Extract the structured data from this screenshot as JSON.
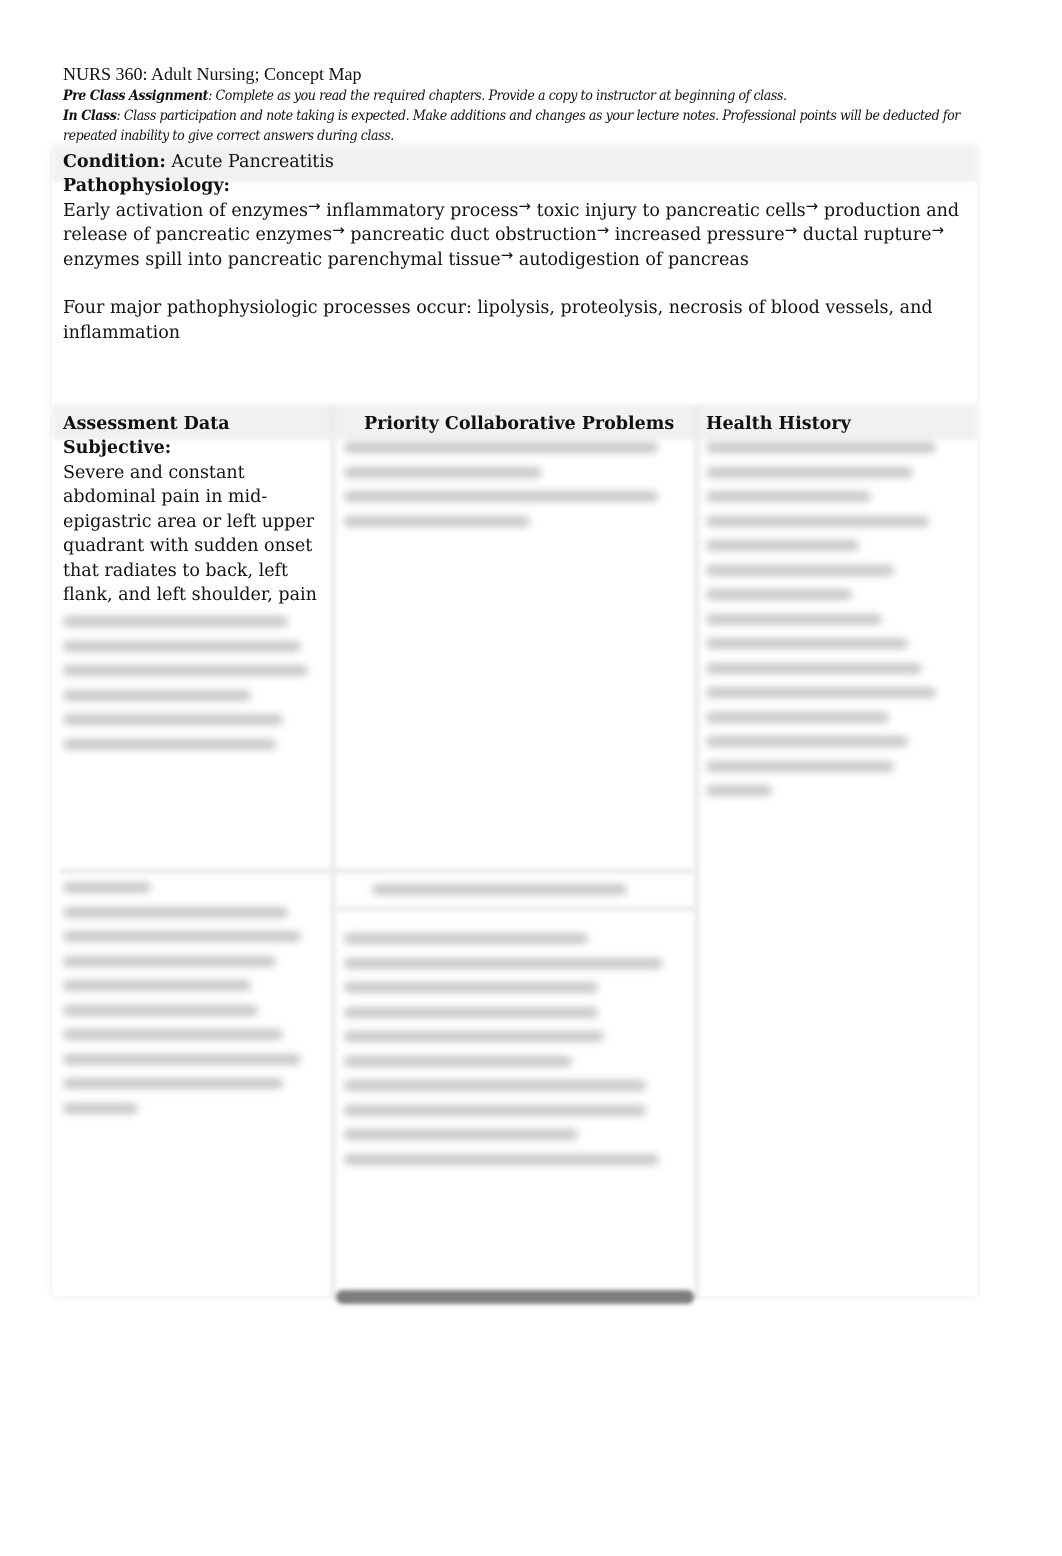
{
  "document": {
    "title": "NURS 360: Adult Nursing; Concept Map",
    "pre_class": {
      "label": "Pre Class Assignment",
      "text": ": Complete as you read the required chapters. Provide a copy to instructor at beginning of class."
    },
    "in_class": {
      "label": "In Class",
      "text": ": Class participation and note taking is expected. Make additions and changes as your lecture notes. Professional points will be deducted for repeated inability to give correct answers during class."
    },
    "condition": {
      "label": "Condition:",
      "value": " Acute Pancreatitis"
    },
    "pathophysiology": {
      "label": "Pathophysiology:",
      "arrow_icon": "→",
      "steps": [
        "Early activation of enzymes",
        "inflammatory process",
        "toxic injury to pancreatic cells",
        "production and release of pancreatic enzymes",
        "pancreatic duct obstruction",
        "increased pressure",
        "ductal rupture",
        "enzymes spill into pancreatic parenchymal tissue",
        "autodigestion of pancreas"
      ],
      "summary": "Four major pathophysiologic processes occur: lipolysis, proteolysis, necrosis of blood vessels, and inflammation"
    },
    "columns": {
      "assessment": "Assessment Data",
      "problems": "Priority Collaborative Problems",
      "history": "Health History"
    },
    "subjective": {
      "label": "Subjective:",
      "text": "Severe and constant abdominal pain in mid-epigastric area or left upper quadrant with sudden onset that radiates to back, left flank, and left shoulder, pain"
    },
    "obscured_sections": {
      "subjective_rest": "blurred",
      "problems": "blurred",
      "history": "blurred",
      "objective": "blurred",
      "lab_heading": "blurred",
      "lab_content": "blurred"
    }
  }
}
